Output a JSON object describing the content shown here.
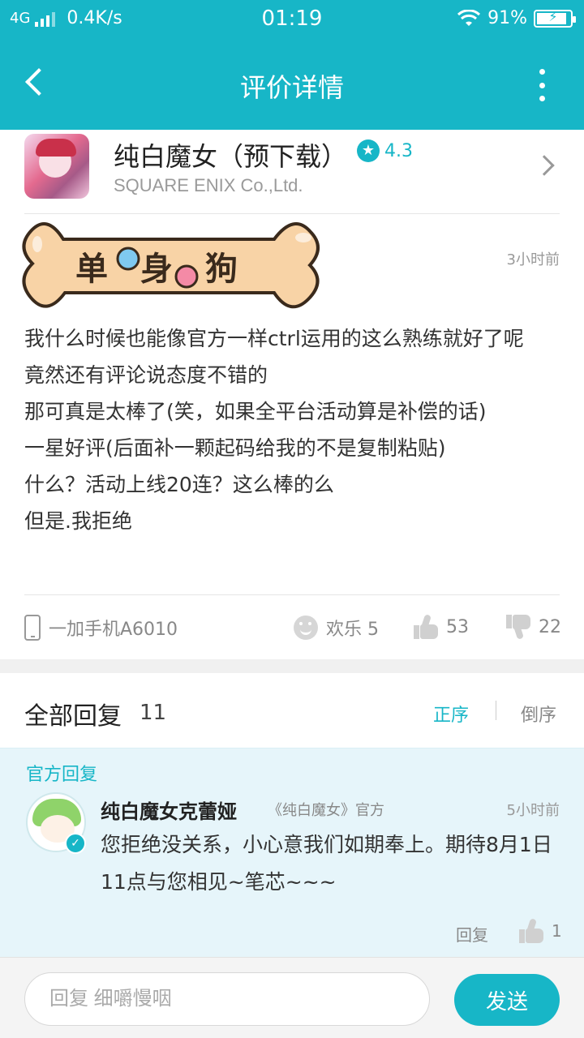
{
  "status_bar": {
    "network": "4G",
    "speed": "0.4K/s",
    "time": "01:19",
    "battery": "91%",
    "battery_level": 0.91
  },
  "nav": {
    "title": "评价详情"
  },
  "app": {
    "name": "纯白魔女（预下载）",
    "rating": "4.3",
    "developer": "SQUARE ENIX Co.,Ltd."
  },
  "review": {
    "badge_text": "单身狗",
    "time": "3小时前",
    "lines": [
      "我什么时候也能像官方一样ctrl运用的这么熟练就好了呢",
      "竟然还有评论说态度不错的",
      "那可真是太棒了(笑，如果全平台活动算是补偿的话)",
      "一星好评(后面补一颗起码给我的不是复制粘贴)",
      "什么？活动上线20连？这么棒的么",
      "但是.我拒绝"
    ],
    "device": "一加手机A6010",
    "happy": "欢乐 5",
    "likes": "53",
    "dislikes": "22"
  },
  "replies": {
    "title": "全部回复",
    "count": "11",
    "sort_asc": "正序",
    "sort_desc": "倒序",
    "official": {
      "tag": "官方回复",
      "user": "纯白魔女克蕾娅",
      "source": "《纯白魔女》官方",
      "time": "5小时前",
      "text": "您拒绝没关系，小心意我们如期奉上。期待8月1日11点与您相见~笔芯~~~",
      "reply_label": "回复",
      "likes": "1"
    }
  },
  "composer": {
    "placeholder": "回复 细嚼慢咽",
    "send_label": "发送"
  },
  "colors": {
    "accent": "#17b6c7",
    "badge_fill": "#f8d3a6",
    "badge_outline": "#3a2a1c"
  }
}
